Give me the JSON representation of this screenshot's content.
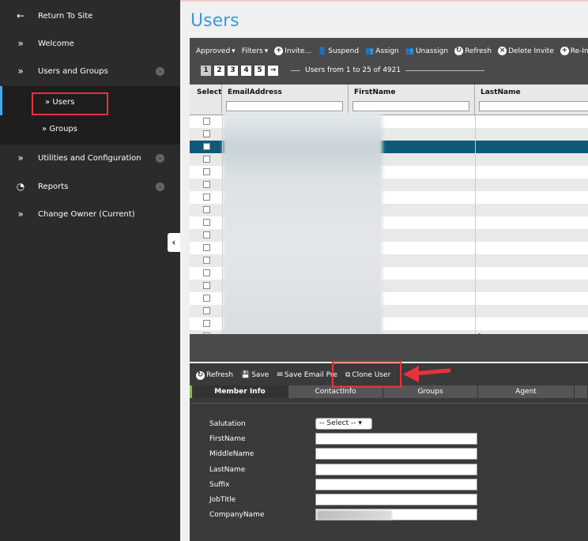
{
  "sidebar": {
    "items": [
      {
        "label": "Return To Site",
        "icon": "arrow-left-icon"
      },
      {
        "label": "Welcome",
        "icon": "double-chevron-icon"
      },
      {
        "label": "Users and Groups",
        "icon": "double-chevron-icon"
      },
      {
        "label": "Utilities and Configuration",
        "icon": "double-chevron-icon"
      },
      {
        "label": "Reports",
        "icon": "pie-chart-icon"
      },
      {
        "label": "Change Owner (Current)",
        "icon": "double-chevron-icon"
      }
    ],
    "subitems": [
      {
        "label": "Users"
      },
      {
        "label": "Groups"
      }
    ]
  },
  "page": {
    "title": "Users"
  },
  "grid_toolbar": {
    "approved": "Approved",
    "filters": "Filters",
    "invite": "Invite...",
    "suspend": "Suspend",
    "assign": "Assign",
    "unassign": "Unassign",
    "refresh": "Refresh",
    "delete_invite": "Delete Invite",
    "reinvite": "Re-Invite"
  },
  "pager": {
    "pages": [
      "1",
      "2",
      "3",
      "4",
      "5"
    ],
    "next": "→",
    "info": "Users from 1 to 25 of 4921"
  },
  "table": {
    "columns": [
      "Select",
      "EmailAddress",
      "FirstName",
      "LastName"
    ],
    "row_count": 18,
    "selected_row": 2,
    "last_row_lastname": "-"
  },
  "detail_toolbar": {
    "refresh": "Refresh",
    "save": "Save",
    "save_email_prefs": "Save Email Pre",
    "clone_user": "Clone User"
  },
  "tabs": [
    "Member Info",
    "ContactInfo",
    "Groups",
    "Agent"
  ],
  "form": {
    "salutation_label": "Salutation",
    "salutation_value": "-- Select --",
    "fields": [
      "FirstName",
      "MiddleName",
      "LastName",
      "Suffix",
      "JobTitle",
      "CompanyName"
    ]
  },
  "colors": {
    "accent": "#3b9ad9",
    "highlight": "#e8323c",
    "selected_row": "#0f5a78",
    "active_tab": "#7cc242"
  }
}
